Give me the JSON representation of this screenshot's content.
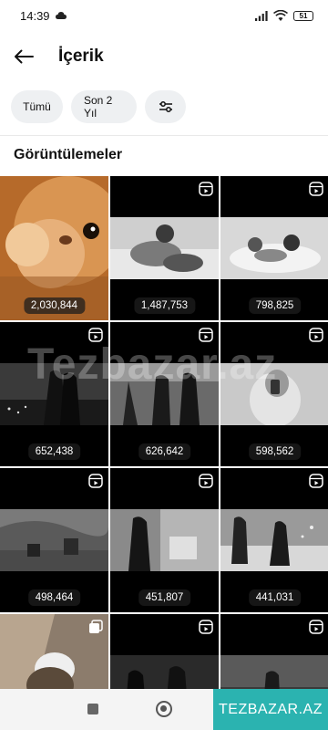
{
  "status": {
    "time": "14:39",
    "battery": "51"
  },
  "header": {
    "title": "İçerik"
  },
  "filters": [
    {
      "label": "Tümü"
    },
    {
      "label": "Son 2 Yıl"
    }
  ],
  "section": {
    "title": "Görüntülemeler"
  },
  "tiles": [
    {
      "views": "2,030,844",
      "type": "photo"
    },
    {
      "views": "1,487,753",
      "type": "reel"
    },
    {
      "views": "798,825",
      "type": "reel"
    },
    {
      "views": "652,438",
      "type": "reel"
    },
    {
      "views": "626,642",
      "type": "reel"
    },
    {
      "views": "598,562",
      "type": "reel"
    },
    {
      "views": "498,464",
      "type": "reel"
    },
    {
      "views": "451,807",
      "type": "reel"
    },
    {
      "views": "441,031",
      "type": "reel"
    },
    {
      "views": "",
      "type": "carousel"
    },
    {
      "views": "",
      "type": "reel"
    },
    {
      "views": "",
      "type": "reel"
    }
  ],
  "watermark": "Tezbazar.az",
  "brand_badge": "TEZBAZAR.AZ"
}
